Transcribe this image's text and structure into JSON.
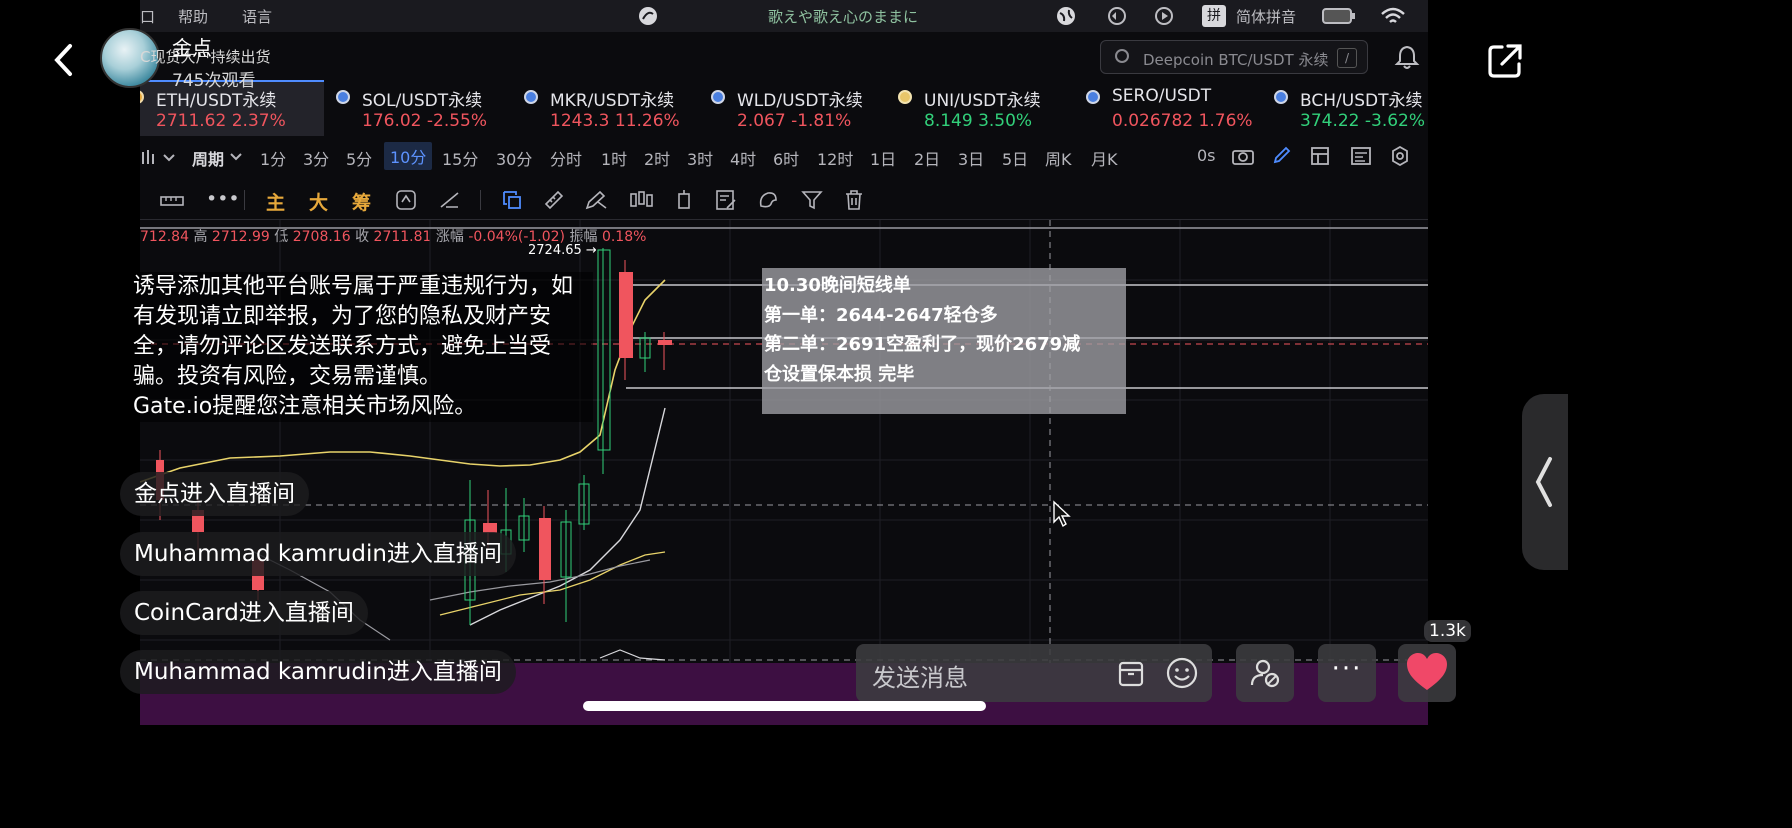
{
  "menubar": {
    "help": "帮助",
    "language": "语言",
    "song": "歌えや歌え心のままに",
    "input_method": "简体拼音",
    "left_fragment": "口"
  },
  "search": {
    "placeholder": "Deepcoin BTC/USDT 永续",
    "shortcut": "/"
  },
  "tickers": [
    {
      "pair": "ETH/USDT永续",
      "price": "2711.62",
      "change": "2.37%",
      "dir": "up"
    },
    {
      "pair": "SOL/USDT永续",
      "price": "176.02",
      "change": "-2.55%",
      "dir": "down"
    },
    {
      "pair": "MKR/USDT永续",
      "price": "1243.3",
      "change": "11.26%",
      "dir": "up"
    },
    {
      "pair": "WLD/USDT永续",
      "price": "2.067",
      "change": "-1.81%",
      "dir": "down"
    },
    {
      "pair": "UNI/USDT永续",
      "price": "8.149",
      "change": "3.50%",
      "dir": "upg"
    },
    {
      "pair": "SERO/USDT",
      "price": "0.026782",
      "change": "1.76%",
      "dir": "up"
    },
    {
      "pair": "BCH/USDT永续",
      "price": "374.22",
      "change": "-3.62%",
      "dir": "downg"
    }
  ],
  "periods": {
    "label": "周期",
    "items": [
      "1分",
      "3分",
      "5分",
      "10分",
      "15分",
      "30分",
      "分时",
      "1时",
      "2时",
      "3时",
      "4时",
      "6时",
      "12时",
      "1日",
      "2日",
      "3日",
      "5日",
      "周K",
      "月K"
    ],
    "active": "10分",
    "countdown": "0s"
  },
  "tools": {
    "main": "主",
    "big": "大",
    "chips": "筹"
  },
  "ohlc": {
    "open": "712.84",
    "high_label": "高",
    "high": "2712.99",
    "low_label": "低",
    "low": "2708.16",
    "close_label": "收",
    "close": "2711.81",
    "change_label": "涨幅",
    "change": "-0.04%(-1.02)",
    "amp_label": "振幅",
    "amp": "0.18%"
  },
  "peak_label": "2724.65 →",
  "signal_note": {
    "title": "10.30晚间短线单",
    "line1": "第一单：2644-2647轻仓多",
    "line2": "第二单：2691空盈利了，现价2679减",
    "line3": "仓设置保本损 完毕"
  },
  "stream": {
    "streamer_name": "金点",
    "subtitle": "C现货大户持续出货",
    "viewers": "745次观看",
    "notice": "诱导添加其他平台账号属于严重违规行为，如有发现请立即举报，为了您的隐私及财产安全，请勿评论区发送联系方式，避免上当受骗。投资有风险，交易需谨慎。",
    "notice2": "Gate.io提醒您注意相关市场风险。",
    "chat": [
      "金点进入直播间",
      "Muhammad kamrudin进入直播间",
      "CoinCard进入直播间",
      "Muhammad kamrudin进入直播间"
    ],
    "message_placeholder": "发送消息",
    "like_count": "1.3k",
    "more": "···"
  },
  "icons": [
    "back-arrow-icon",
    "share-icon",
    "bell-icon",
    "search-icon",
    "camera-icon",
    "pencil-icon",
    "settings-icon",
    "gift-icon",
    "emoji-icon",
    "user-settings-icon",
    "heart-icon",
    "chevron-left-icon",
    "wifi-icon",
    "battery-icon"
  ],
  "colors": {
    "up": "#f0555e",
    "down": "#32d07a",
    "accent": "#4f8cff",
    "heart": "#f04868"
  }
}
